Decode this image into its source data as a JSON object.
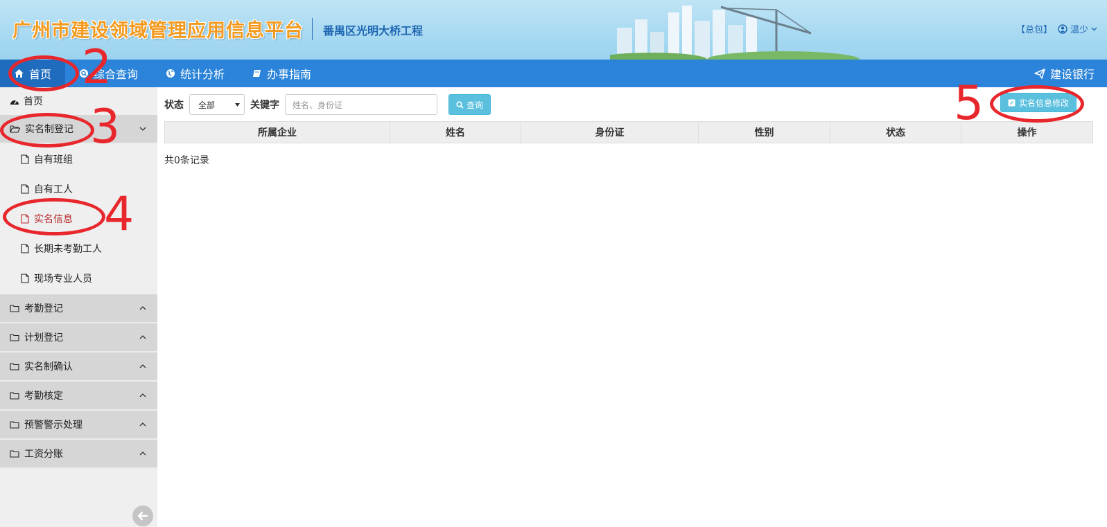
{
  "header": {
    "title": "广州市建设领域管理应用信息平台",
    "project": "番禺区光明大桥工程",
    "role": "【总包】",
    "user": "温少"
  },
  "topnav": {
    "items": [
      {
        "label": "首页",
        "icon": "home-icon"
      },
      {
        "label": "综合查询",
        "icon": "search-icon"
      },
      {
        "label": "统计分析",
        "icon": "globe-icon"
      },
      {
        "label": "办事指南",
        "icon": "book-icon"
      }
    ],
    "right": {
      "label": "建设银行",
      "icon": "paper-plane-icon"
    }
  },
  "sidebar": {
    "home": "首页",
    "expanded_group": {
      "label": "实名制登记",
      "items": [
        "自有班组",
        "自有工人",
        "实名信息",
        "长期未考勤工人",
        "现场专业人员"
      ]
    },
    "groups": [
      "考勤登记",
      "计划登记",
      "实名制确认",
      "考勤核定",
      "预警警示处理",
      "工资分账"
    ]
  },
  "filter": {
    "status_label": "状态",
    "status_value": "全部",
    "keyword_label": "关键字",
    "keyword_placeholder": "姓名、身份证",
    "query_button": "查询",
    "edit_button": "实名信息修改"
  },
  "table": {
    "columns": [
      "所属企业",
      "姓名",
      "身份证",
      "性别",
      "状态",
      "操作"
    ],
    "record_count": "共0条记录"
  },
  "annotations": [
    "2",
    "3",
    "4",
    "5"
  ],
  "colors": {
    "nav_bg": "#2b84d9",
    "nav_active": "#1f6cbf",
    "button": "#5bc0de",
    "annotation": "#e8272d",
    "active_sub": "#b5252a"
  }
}
